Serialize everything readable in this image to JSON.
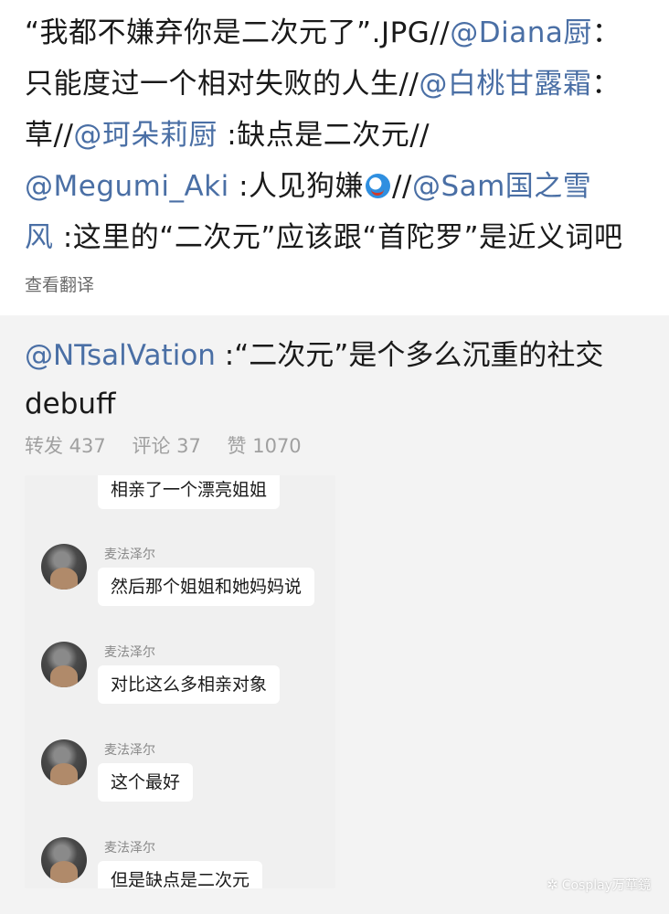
{
  "comment": {
    "line1": {
      "a": "“我都不嫌弃你是二次元了”.JPG//",
      "m1": "@Diana厨",
      "b": "："
    },
    "line2": {
      "a": "只能度过一个相对失败的人生//",
      "m1": "@白桃甘露霜",
      "b": "："
    },
    "line3": {
      "a": "草//",
      "m1": "@珂朵莉厨",
      "b": " :缺点是二次元//"
    },
    "line4": {
      "m1": "@Megumi_Aki",
      "a": " :人见狗嫌",
      "emoji": "doraemon-emoji",
      "b": "//",
      "m2": "@Sam国之雪"
    },
    "line5": {
      "m1": "风",
      "a": " :这里的“二次元”应该跟“首陀罗”是近义词吧"
    },
    "translate": "查看翻译"
  },
  "repost": {
    "user": "@NTsalVation",
    "text1": " :“二次元”是个多么沉重的社交",
    "text2": "debuff",
    "stats": {
      "repost": "转发 437",
      "comment": "评论 37",
      "like": "赞 1070"
    }
  },
  "chat": {
    "messages": [
      {
        "text": "相亲了一个漂亮姐姐"
      },
      {
        "nick": "麦法泽尔",
        "text": "然后那个姐姐和她妈妈说"
      },
      {
        "nick": "麦法泽尔",
        "text": "对比这么多相亲对象"
      },
      {
        "nick": "麦法泽尔",
        "text": "这个最好"
      },
      {
        "nick": "麦法泽尔",
        "text": "但是缺点是二次元"
      }
    ]
  },
  "watermark": "Cosplay万華鏡"
}
